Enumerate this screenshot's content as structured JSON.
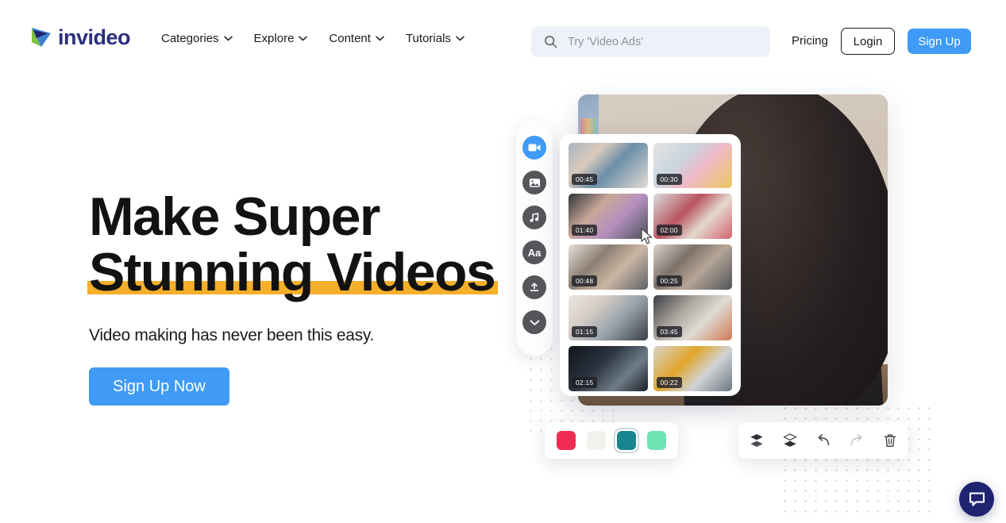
{
  "brand": {
    "name": "invideo",
    "logo_icon": "play-triangle-logo",
    "text_color": "#2b2f7c",
    "accent_blue": "#3f9bf5",
    "highlight_orange": "#f5af2b"
  },
  "header": {
    "nav": [
      {
        "label": "Categories",
        "icon": "chevron-down-icon"
      },
      {
        "label": "Explore",
        "icon": "chevron-down-icon"
      },
      {
        "label": "Content",
        "icon": "chevron-down-icon"
      },
      {
        "label": "Tutorials",
        "icon": "chevron-down-icon"
      }
    ],
    "search": {
      "placeholder": "Try 'Video Ads'",
      "value": "",
      "icon": "search-icon"
    },
    "pricing_label": "Pricing",
    "login_label": "Login",
    "signup_label": "Sign Up"
  },
  "hero": {
    "headline_line1": "Make Super",
    "headline_line2": "Stunning Videos",
    "subtitle": "Video making has never been this easy.",
    "cta_label": "Sign Up Now"
  },
  "editor": {
    "toolbar": [
      {
        "name": "video-icon",
        "active": true
      },
      {
        "name": "image-icon",
        "active": false
      },
      {
        "name": "music-icon",
        "active": false
      },
      {
        "name": "text-icon",
        "label": "Aa",
        "active": false
      },
      {
        "name": "upload-icon",
        "active": false
      },
      {
        "name": "chevron-down-icon",
        "active": false
      }
    ],
    "clips": [
      {
        "duration": "00:45"
      },
      {
        "duration": "00:30"
      },
      {
        "duration": "01:40"
      },
      {
        "duration": "02:00"
      },
      {
        "duration": "00:48"
      },
      {
        "duration": "00:25"
      },
      {
        "duration": "01:15"
      },
      {
        "duration": "03:45"
      },
      {
        "duration": "02:15"
      },
      {
        "duration": "00:22"
      }
    ],
    "swatches": [
      {
        "color": "#ef2d54",
        "selected": false
      },
      {
        "color": "#f2f1ee",
        "selected": false
      },
      {
        "color": "#17868f",
        "selected": true
      },
      {
        "color": "#6fe3b4",
        "selected": false
      }
    ],
    "actions": [
      {
        "name": "bring-forward-icon",
        "disabled": false
      },
      {
        "name": "send-backward-icon",
        "disabled": false
      },
      {
        "name": "undo-icon",
        "disabled": false
      },
      {
        "name": "redo-icon",
        "disabled": true
      },
      {
        "name": "delete-icon",
        "disabled": false
      }
    ]
  },
  "chat_widget": {
    "icon": "chat-bubble-icon",
    "color": "#1f2470"
  }
}
